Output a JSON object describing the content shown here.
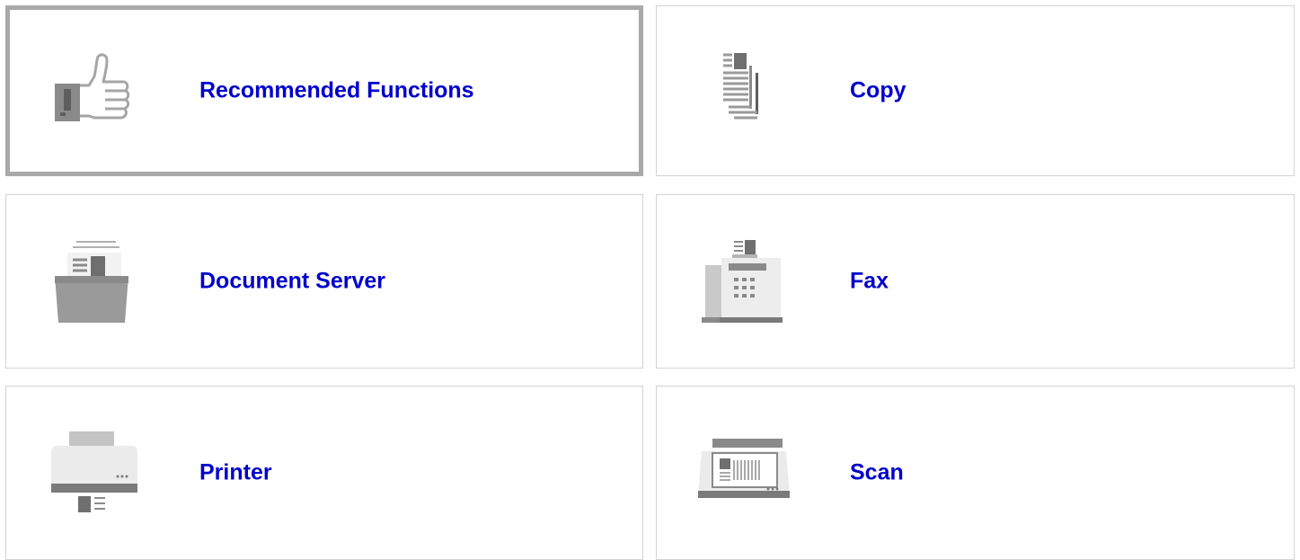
{
  "tiles": [
    {
      "label": "Recommended Functions",
      "icon": "thumbs-up-icon",
      "selected": true
    },
    {
      "label": "Copy",
      "icon": "copy-icon",
      "selected": false
    },
    {
      "label": "Document Server",
      "icon": "document-server-icon",
      "selected": false
    },
    {
      "label": "Fax",
      "icon": "fax-icon",
      "selected": false
    },
    {
      "label": "Printer",
      "icon": "printer-icon",
      "selected": false
    },
    {
      "label": "Scan",
      "icon": "scanner-icon",
      "selected": false
    }
  ],
  "colors": {
    "label": "#0000cc",
    "tile_border": "#d3d3d3",
    "selected_border": "#a9a9a9",
    "icon_gray": "#9a9a9a",
    "icon_dark": "#6f6f6f"
  }
}
